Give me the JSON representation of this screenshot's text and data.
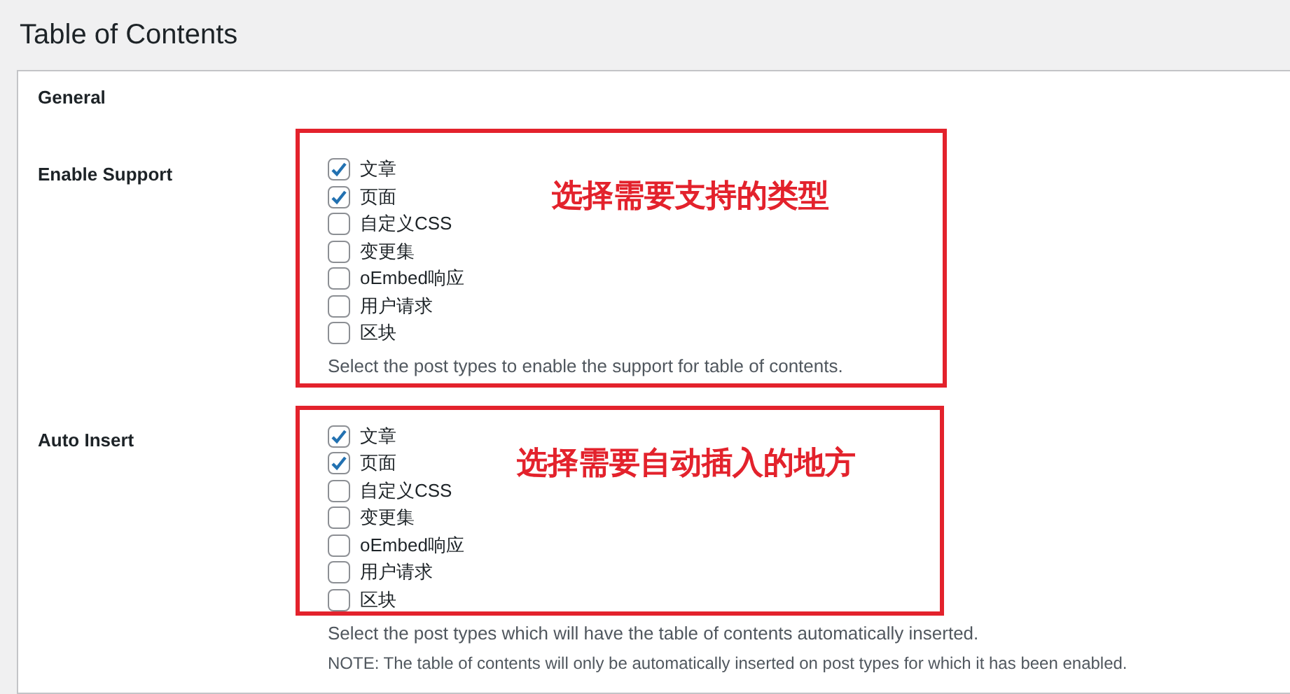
{
  "page": {
    "title": "Table of Contents"
  },
  "section": {
    "title": "General",
    "rows": [
      {
        "label": "Enable Support",
        "options": [
          {
            "label": "文章",
            "checked": true
          },
          {
            "label": "页面",
            "checked": true
          },
          {
            "label": "自定义CSS",
            "checked": false
          },
          {
            "label": "变更集",
            "checked": false
          },
          {
            "label": "oEmbed响应",
            "checked": false
          },
          {
            "label": "用户请求",
            "checked": false
          },
          {
            "label": "区块",
            "checked": false
          }
        ],
        "descriptions": [
          "Select the post types to enable the support for table of contents."
        ],
        "annotation": "选择需要支持的类型"
      },
      {
        "label": "Auto Insert",
        "options": [
          {
            "label": "文章",
            "checked": true
          },
          {
            "label": "页面",
            "checked": true
          },
          {
            "label": "自定义CSS",
            "checked": false
          },
          {
            "label": "变更集",
            "checked": false
          },
          {
            "label": "oEmbed响应",
            "checked": false
          },
          {
            "label": "用户请求",
            "checked": false
          },
          {
            "label": "区块",
            "checked": false
          }
        ],
        "descriptions": [
          "Select the post types which will have the table of contents automatically inserted.",
          "NOTE: The table of contents will only be automatically inserted on post types for which it has been enabled."
        ],
        "annotation": "选择需要自动插入的地方"
      }
    ]
  }
}
